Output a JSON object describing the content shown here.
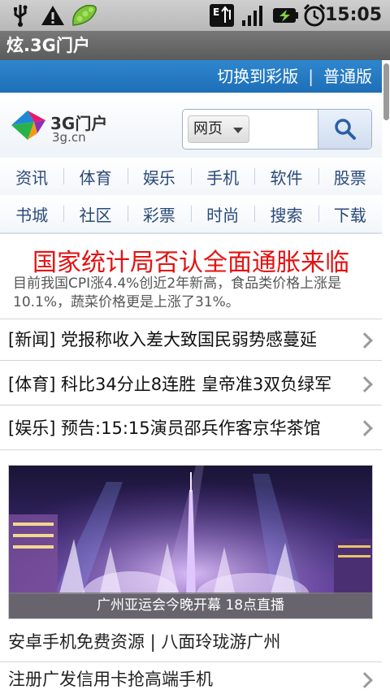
{
  "status": {
    "time": "15:05",
    "icons": [
      "usb-icon",
      "warning-icon",
      "pea-pod-icon",
      "data-transfer-icon",
      "signal-icon",
      "battery-icon",
      "alarm-icon"
    ]
  },
  "app": {
    "title": "炫.3G门户"
  },
  "topbar": {
    "color_link": "切换到彩版",
    "separator": "|",
    "normal_link": "普通版"
  },
  "header": {
    "logo_text": "3G门户",
    "logo_sub": "3g.cn",
    "search": {
      "select_value": "网页",
      "placeholder": ""
    }
  },
  "nav": {
    "row1": [
      "资讯",
      "体育",
      "娱乐",
      "手机",
      "软件",
      "股票"
    ],
    "row2": [
      "书城",
      "社区",
      "彩票",
      "时尚",
      "搜索",
      "下载"
    ]
  },
  "headline": {
    "title": "国家统计局否认全面通胀来临",
    "summary": "目前我国CPI涨4.4%创近2年新高，食品类价格上涨是10.1%，蔬菜价格更是上涨了31%。"
  },
  "news": [
    {
      "text": "[新闻] 党报称收入差大致国民弱势感蔓延"
    },
    {
      "text": "[体育] 科比34分止8连胜 皇帝准3双负绿军"
    },
    {
      "text": "[娱乐] 预告:15:15演员邵兵作客京华茶馆"
    }
  ],
  "photo": {
    "caption": "广州亚运会今晚开幕 18点直播"
  },
  "promo": {
    "line1": "安卓手机免费资源 | 八面玲珑游广州",
    "line2": "注册广发信用卡抢高端手机"
  },
  "colors": {
    "accent_blue": "#1d6fb6",
    "headline_red": "#e51212",
    "nav_text": "#2a4a78"
  }
}
